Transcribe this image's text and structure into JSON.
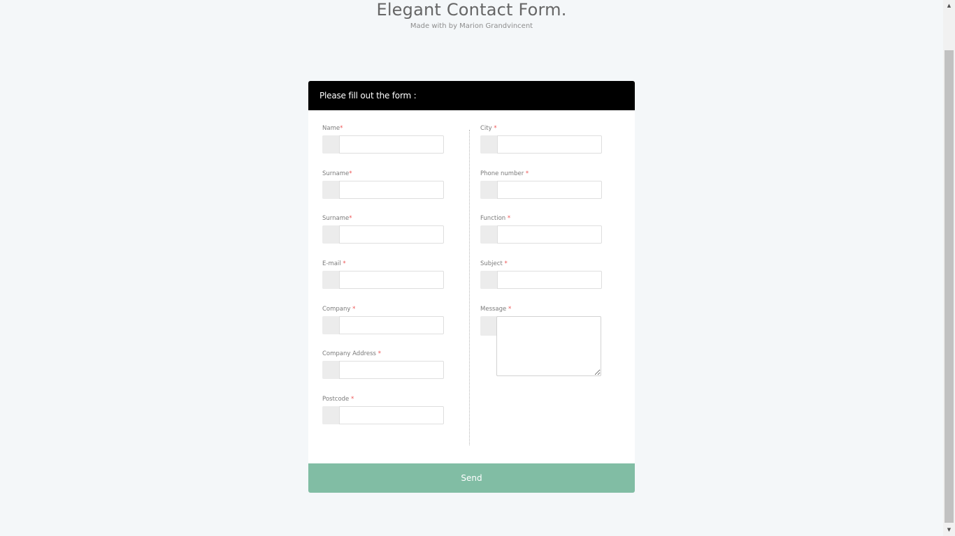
{
  "page": {
    "title": "Elegant Contact Form.",
    "subtitle": "Made with by Marion Grandvincent"
  },
  "form": {
    "header": "Please fill out the form :",
    "required_mark": "*",
    "left_fields": [
      {
        "label": "Name",
        "req": "*"
      },
      {
        "label": "Surname",
        "req": "*"
      },
      {
        "label": "Surname",
        "req": "*"
      },
      {
        "label": "E-mail ",
        "req": "*"
      },
      {
        "label": "Company ",
        "req": "*"
      },
      {
        "label": "Company Address ",
        "req": "*"
      },
      {
        "label": "Postcode ",
        "req": "*"
      }
    ],
    "right_fields": [
      {
        "label": "City ",
        "req": "*"
      },
      {
        "label": "Phone number ",
        "req": "*"
      },
      {
        "label": "Function ",
        "req": "*"
      },
      {
        "label": "Subject ",
        "req": "*"
      }
    ],
    "message": {
      "label": "Message ",
      "req": "*"
    },
    "send_label": "Send"
  },
  "colors": {
    "header_bg": "#000000",
    "send_bg": "#81bda4",
    "page_bg": "#f4f7f9",
    "required": "#ee5555"
  },
  "icons": {
    "scroll_up": "scroll-up-arrow-icon",
    "scroll_down": "scroll-down-arrow-icon"
  }
}
